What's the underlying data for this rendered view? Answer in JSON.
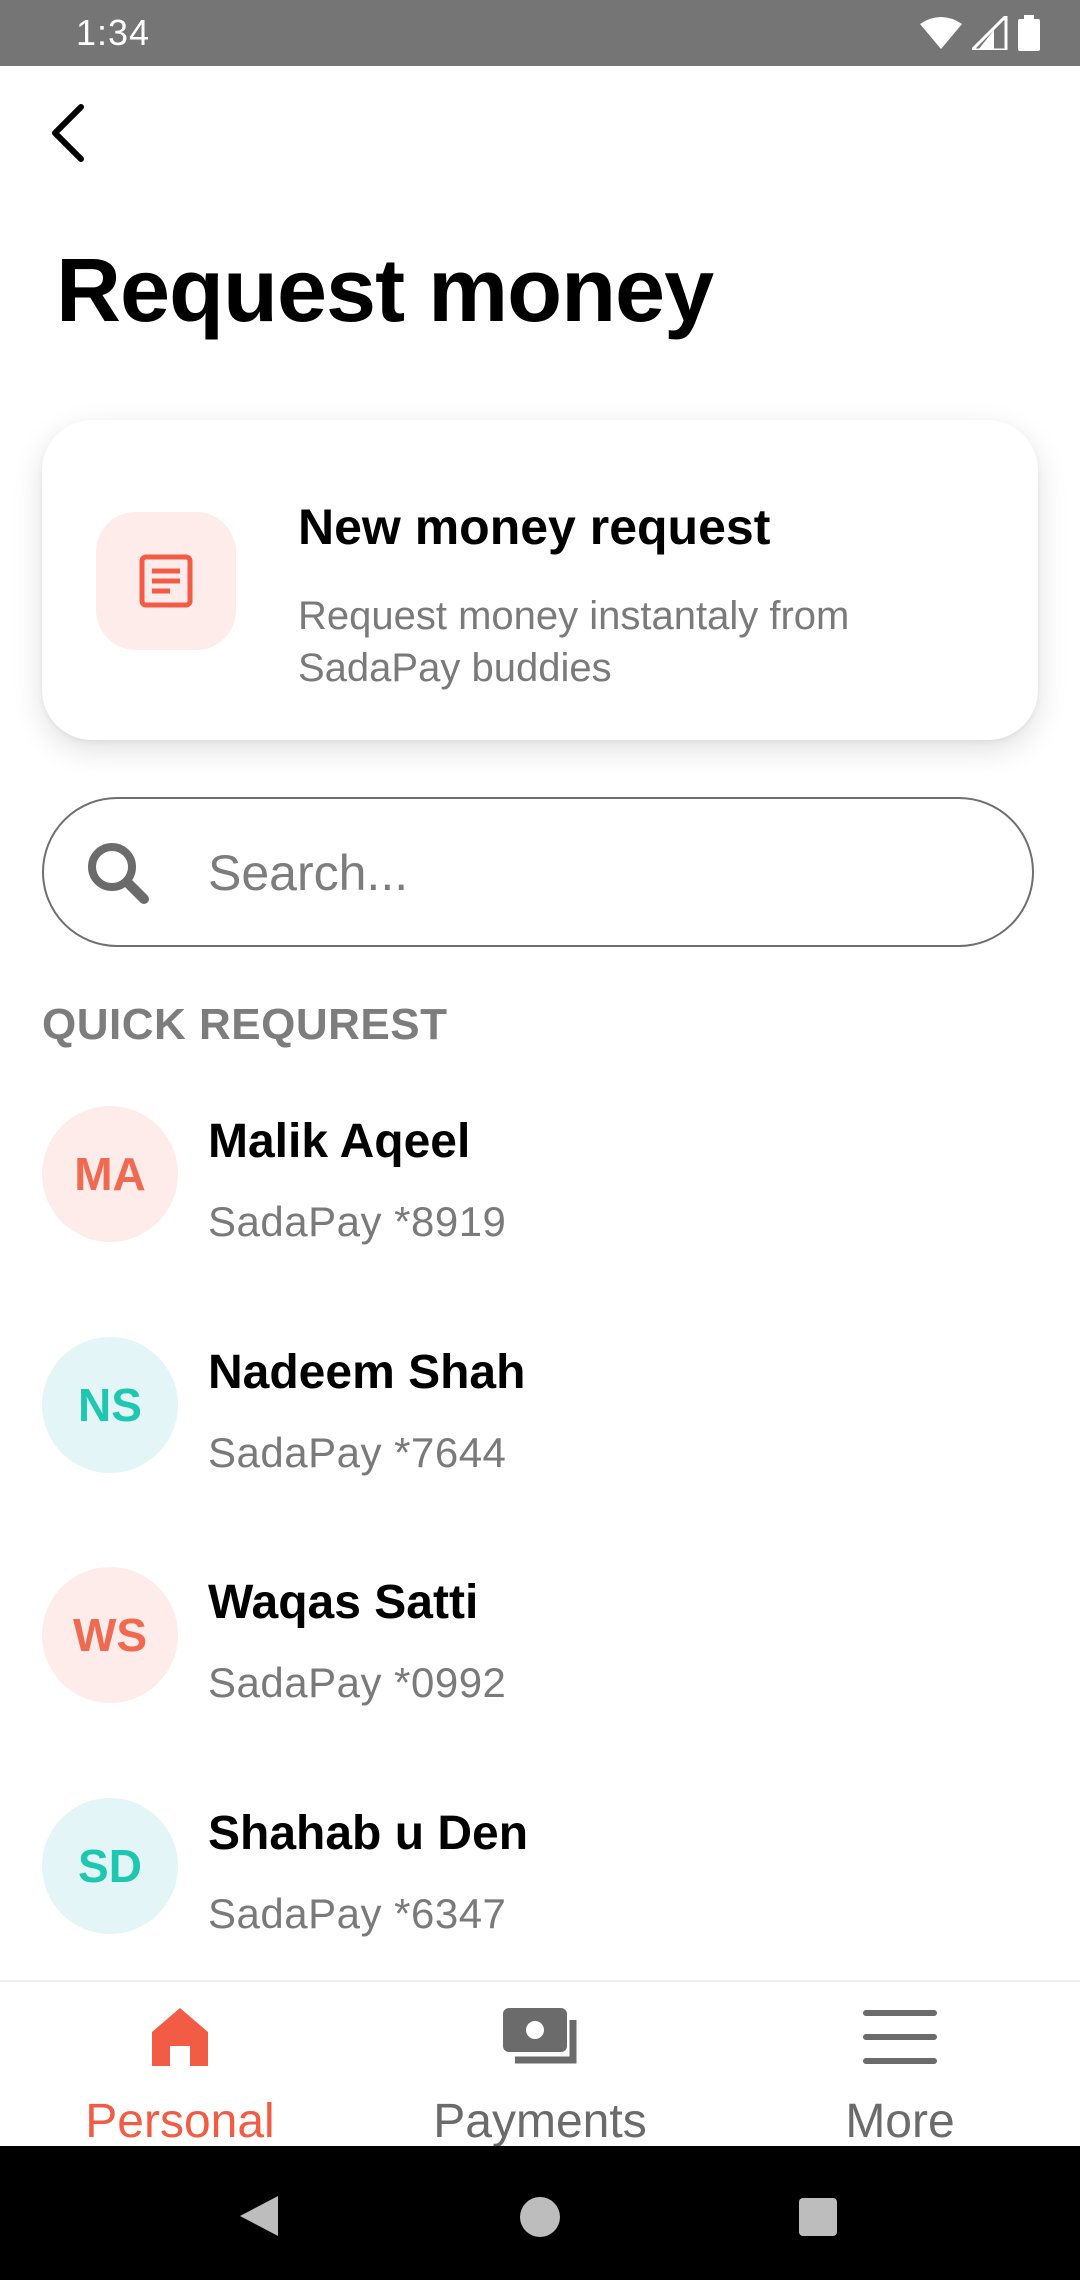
{
  "status_bar": {
    "time": "1:34",
    "icons": [
      "wifi-icon",
      "cellular-signal-icon",
      "battery-icon"
    ]
  },
  "header": {
    "back_icon": "chevron-left-icon",
    "title": "Request money"
  },
  "new_request_card": {
    "icon": "document-icon",
    "title": "New money request",
    "subtitle": "Request money instantaly from SadaPay buddies"
  },
  "search": {
    "icon": "search-icon",
    "placeholder": "Search...",
    "value": ""
  },
  "quick_request": {
    "label": "QUICK REQUREST",
    "contacts": [
      {
        "initials": "MA",
        "name": "Malik Aqeel",
        "account": "SadaPay *8919",
        "avatar_bg": "#fdecea",
        "avatar_fg": "#f06a52"
      },
      {
        "initials": "NS",
        "name": "Nadeem Shah",
        "account": "SadaPay *7644",
        "avatar_bg": "#e3f5f7",
        "avatar_fg": "#1ec8b0"
      },
      {
        "initials": "WS",
        "name": "Waqas Satti",
        "account": "SadaPay *0992",
        "avatar_bg": "#fdecea",
        "avatar_fg": "#f06a52"
      },
      {
        "initials": "SD",
        "name": "Shahab u Den",
        "account": "SadaPay *6347",
        "avatar_bg": "#e3f5f7",
        "avatar_fg": "#1ec8b0"
      }
    ]
  },
  "bottom_nav": {
    "items": [
      {
        "label": "Personal",
        "icon": "home-icon",
        "active": true
      },
      {
        "label": "Payments",
        "icon": "payments-icon",
        "active": false
      },
      {
        "label": "More",
        "icon": "menu-icon",
        "active": false
      }
    ]
  },
  "colors": {
    "accent": "#f25c45",
    "inactive": "#6b6b6b",
    "muted_text": "#7a7a7a"
  }
}
